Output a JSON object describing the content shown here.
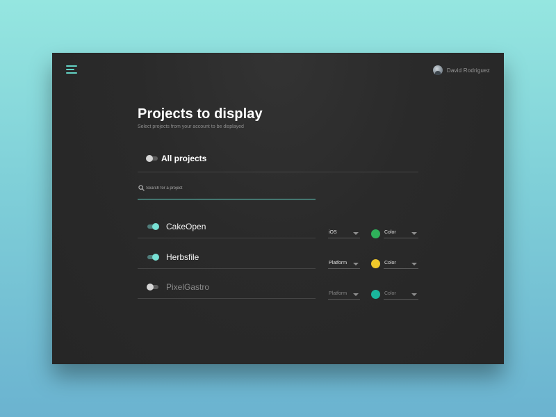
{
  "header": {
    "menu_icon": "hamburger-icon",
    "user_name": "David Rodriguez",
    "avatar_icon": "user-avatar"
  },
  "page": {
    "title": "Projects to display",
    "subtitle": "Select projects from your account to be displayed"
  },
  "all_projects": {
    "label": "All projects",
    "enabled": false
  },
  "search": {
    "placeholder": "Search for a project",
    "value": "",
    "icon": "search-icon"
  },
  "projects": [
    {
      "name": "CakeOpen",
      "enabled": true,
      "platform": "iOS",
      "color_label": "Color",
      "color": "#2fb15a"
    },
    {
      "name": "Herbsfile",
      "enabled": true,
      "platform": "Platform",
      "color_label": "Color",
      "color": "#f1c92b"
    },
    {
      "name": "PixelGastro",
      "enabled": false,
      "platform": "Platform",
      "color_label": "Color",
      "color": "#1ab59b"
    }
  ],
  "colors": {
    "accent": "#63d3c5",
    "panel": "#2a2a2a",
    "background_top": "#95e6e0",
    "background_bottom": "#6bb3d0"
  }
}
